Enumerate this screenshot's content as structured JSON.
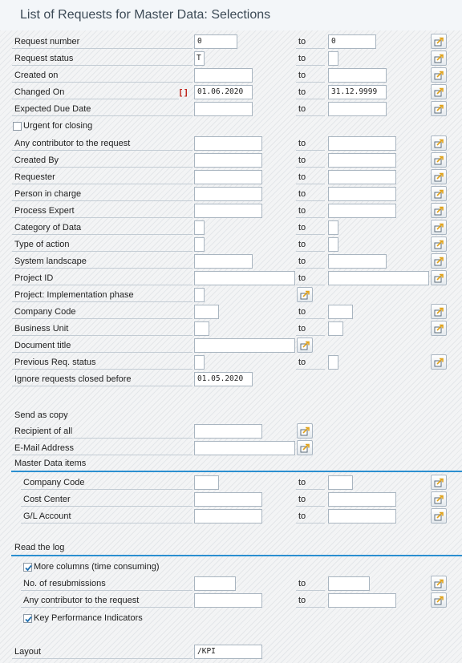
{
  "window": {
    "title": "List of Requests for Master Data: Selections"
  },
  "common": {
    "to_label": "to"
  },
  "rows": {
    "request_number": {
      "label": "Request number",
      "from": "0",
      "to": "0"
    },
    "request_status": {
      "label": "Request status",
      "from": "T",
      "to": ""
    },
    "created_on": {
      "label": "Created on",
      "from": "",
      "to": ""
    },
    "changed_on": {
      "label": "Changed On",
      "indicator": "[]",
      "from": "01.06.2020",
      "to": "31.12.9999"
    },
    "expected_due_date": {
      "label": "Expected Due Date",
      "from": "",
      "to": ""
    },
    "urgent": {
      "label": "Urgent for closing",
      "checked": false
    },
    "any_contributor": {
      "label": "Any contributor to the request",
      "from": "",
      "to": ""
    },
    "created_by": {
      "label": "Created By",
      "from": "",
      "to": ""
    },
    "requester": {
      "label": "Requester",
      "from": "",
      "to": ""
    },
    "person_in_charge": {
      "label": "Person in charge",
      "from": "",
      "to": ""
    },
    "process_expert": {
      "label": "Process Expert",
      "from": "",
      "to": ""
    },
    "category_of_data": {
      "label": "Category of Data",
      "from": "",
      "to": ""
    },
    "type_of_action": {
      "label": "Type of action",
      "from": "",
      "to": ""
    },
    "system_landscape": {
      "label": "System landscape",
      "from": "",
      "to": ""
    },
    "project_id": {
      "label": "Project ID",
      "from": "",
      "to": ""
    },
    "project_phase": {
      "label": "Project: Implementation phase",
      "from": ""
    },
    "company_code": {
      "label": "Company Code",
      "from": "",
      "to": ""
    },
    "business_unit": {
      "label": "Business Unit",
      "from": "",
      "to": ""
    },
    "document_title": {
      "label": "Document title",
      "from": ""
    },
    "previous_status": {
      "label": "Previous Req. status",
      "from": "",
      "to": ""
    },
    "ignore_closed": {
      "label": "Ignore requests closed before",
      "value": "01.05.2020"
    }
  },
  "send_copy": {
    "heading": "Send as copy",
    "recipient": {
      "label": "Recipient of all",
      "value": ""
    },
    "email": {
      "label": "E-Mail Address",
      "value": ""
    }
  },
  "master_data": {
    "title": "Master Data items",
    "company_code": {
      "label": "Company Code",
      "from": "",
      "to": ""
    },
    "cost_center": {
      "label": "Cost Center",
      "from": "",
      "to": ""
    },
    "gl_account": {
      "label": "G/L Account",
      "from": "",
      "to": ""
    }
  },
  "read_log": {
    "title": "Read the log",
    "more_columns": {
      "label": "More columns (time consuming)",
      "checked": true
    },
    "resubmissions": {
      "label": "No. of resubmissions",
      "from": "",
      "to": ""
    },
    "any_contributor": {
      "label": "Any contributor to the request",
      "from": "",
      "to": ""
    },
    "kpi": {
      "label": "Key Performance Indicators",
      "checked": true
    }
  },
  "layout": {
    "label": "Layout",
    "value": "/KPI"
  },
  "icons": {
    "multiple_selection": "multiple-selection-icon",
    "checkbox_check": "checkmark-icon"
  },
  "colors": {
    "accent": "#2b8fd0",
    "indicator": "#c0241b",
    "title": "#3c4a56"
  }
}
